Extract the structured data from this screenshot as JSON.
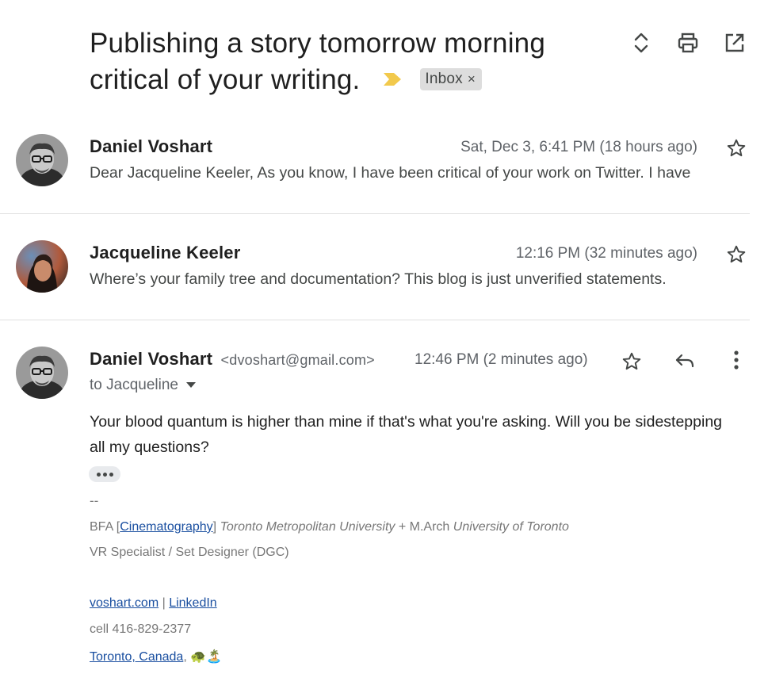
{
  "subject": {
    "title": "Publishing a story tomorrow morning critical of your writing.",
    "label": "Inbox",
    "label_remove": "×",
    "importance_color": "#f2c94c"
  },
  "toolbar": {
    "icons": [
      "expand-collapse-icon",
      "print-icon",
      "open-new-window-icon"
    ]
  },
  "messages": [
    {
      "sender": "Daniel Voshart",
      "date": "Sat, Dec 3, 6:41 PM (18 hours ago)",
      "snippet": "Dear Jacqueline Keeler, As you know, I have been critical of your work on Twitter. I have"
    },
    {
      "sender": "Jacqueline Keeler",
      "date": "12:16 PM (32 minutes ago)",
      "snippet": "Where’s your family tree and documentation? This blog is just unverified statements."
    },
    {
      "sender": "Daniel Voshart",
      "email": "<dvoshart@gmail.com>",
      "date": "12:46 PM (2 minutes ago)",
      "to": "to Jacqueline",
      "body": "Your blood quantum is higher than mine if that's what you're asking. Will you be sidestepping all my questions?",
      "signature": {
        "separator": "--",
        "degree_prefix": "BFA [",
        "degree_link": "Cinematography",
        "degree_suffix": "]",
        "school1": "Toronto Metropolitan University",
        "plus": " + M.Arch ",
        "school2": "University of Toronto",
        "role": "VR Specialist / Set Designer (DGC)",
        "website": "voshart.com",
        "pipe": " | ",
        "linkedin": "LinkedIn",
        "cell": "cell 416-829-2377",
        "location": "Toronto, Canada",
        "location_suffix": ",",
        "emoji": "🐢🏝️"
      }
    }
  ],
  "colors": {
    "link": "#1a4fa0",
    "divider": "#e0e0e0",
    "chip_bg": "#dddddd"
  }
}
